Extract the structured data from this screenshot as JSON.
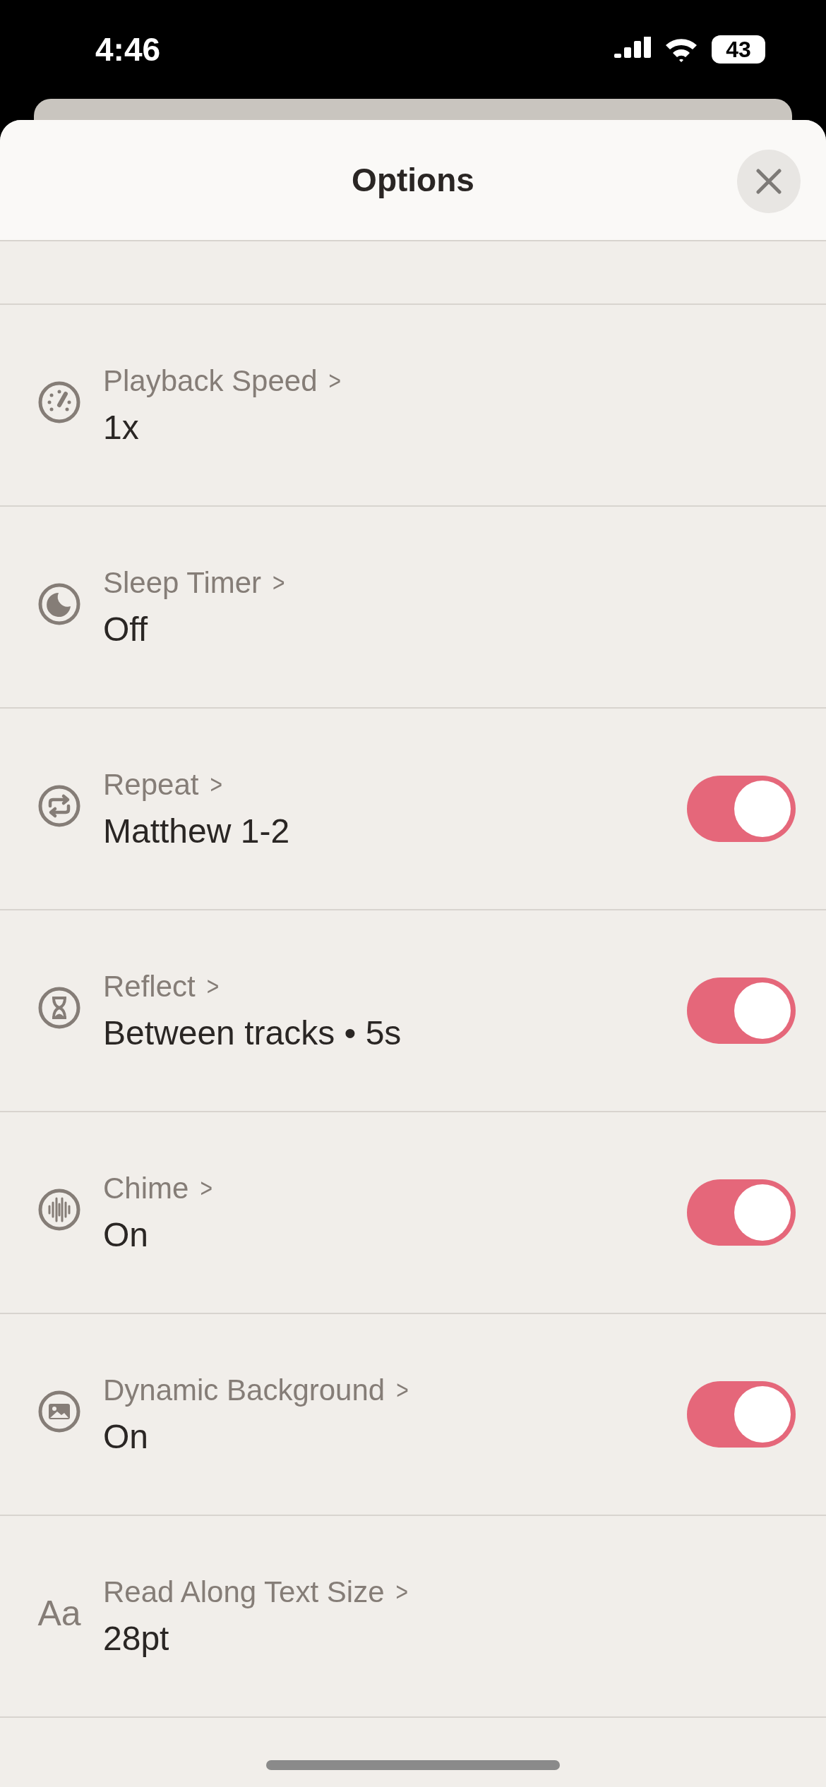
{
  "status_bar": {
    "time": "4:46",
    "battery": "43"
  },
  "sheet": {
    "title": "Options"
  },
  "rows": [
    {
      "kind": "link",
      "label": "Playback Speed",
      "chevron": ">",
      "value": "1x"
    },
    {
      "kind": "link",
      "label": "Sleep Timer",
      "chevron": ">",
      "value": "Off"
    },
    {
      "kind": "toggle",
      "label": "Repeat",
      "chevron": ">",
      "value": "Matthew 1-2",
      "on": true
    },
    {
      "kind": "toggle",
      "label": "Reflect",
      "chevron": ">",
      "value": "Between tracks • 5s",
      "on": true
    },
    {
      "kind": "toggle",
      "label": "Chime",
      "chevron": ">",
      "value": "On",
      "on": true
    },
    {
      "kind": "toggle",
      "label": "Dynamic Background",
      "chevron": ">",
      "value": "On",
      "on": true
    },
    {
      "kind": "link",
      "label": "Read Along Text Size",
      "chevron": ">",
      "value": "28pt",
      "icon_text": "Aa"
    }
  ]
}
